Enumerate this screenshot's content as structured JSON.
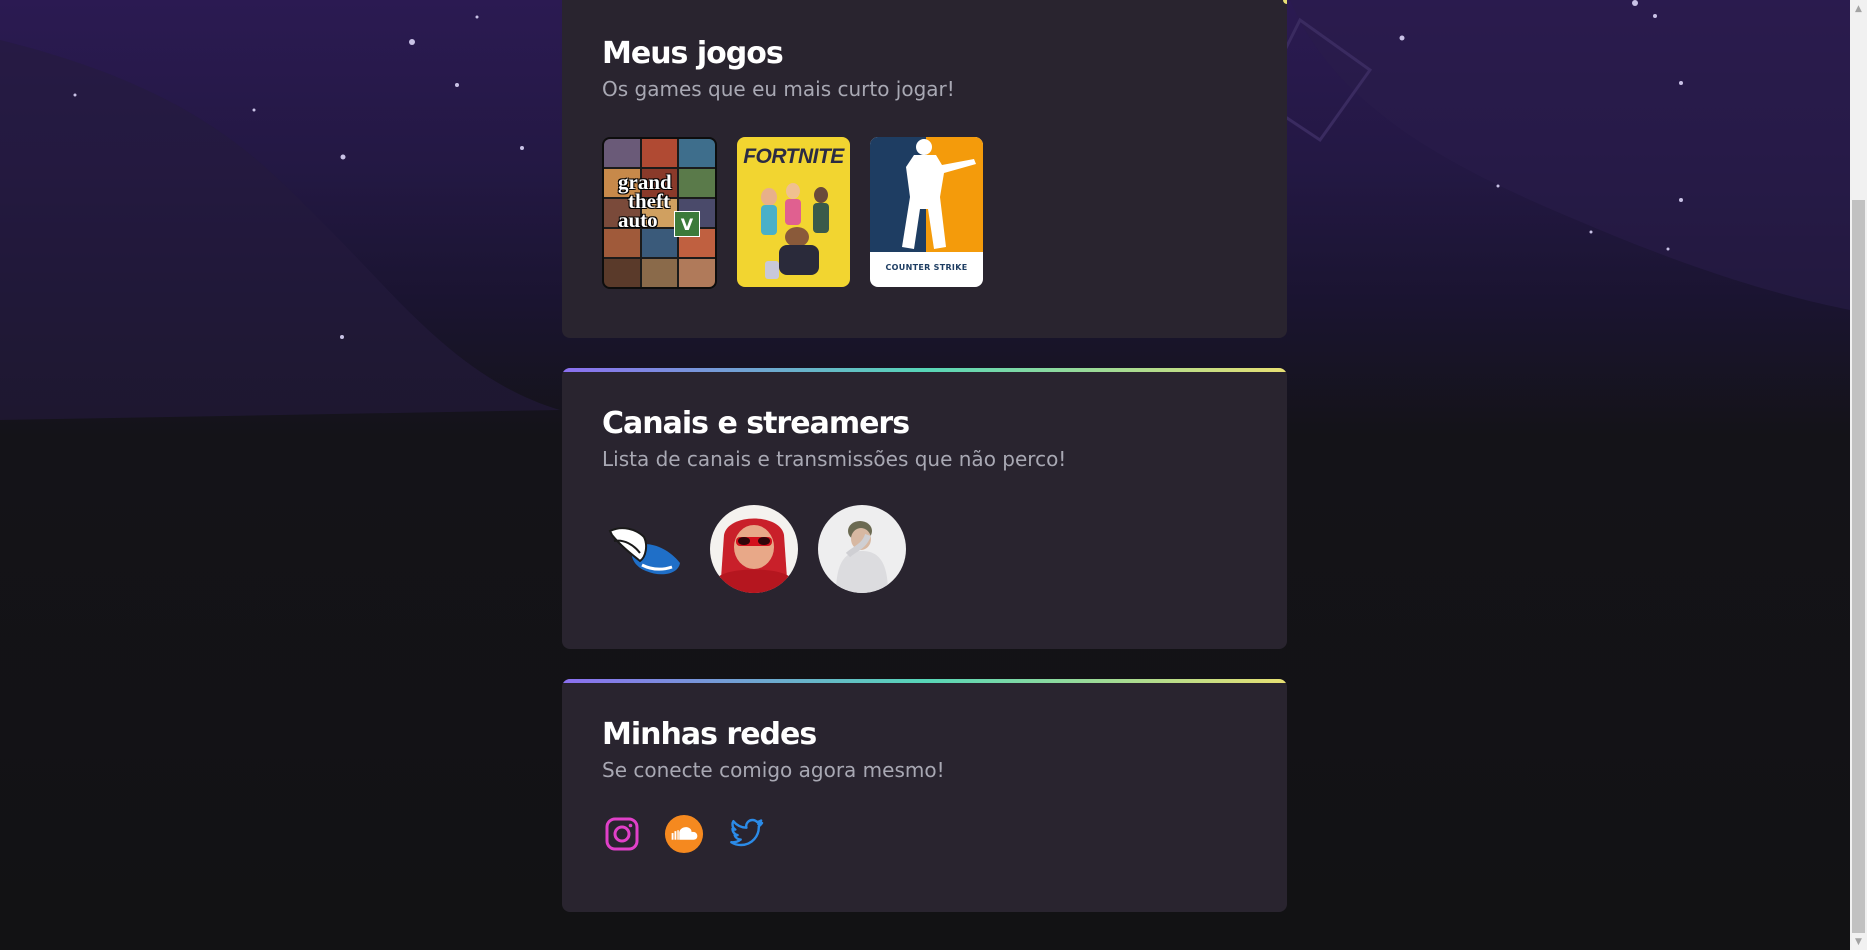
{
  "sections": {
    "games": {
      "title": "Meus jogos",
      "subtitle": "Os games que eu mais curto jogar!",
      "items": [
        {
          "name": "Grand Theft Auto V",
          "cover_text": [
            "grand",
            "theft",
            "auto"
          ],
          "badge": "V"
        },
        {
          "name": "Fortnite",
          "cover_text": "FORTNITE"
        },
        {
          "name": "Counter-Strike",
          "cover_text": "COUNTER STRIKE"
        }
      ]
    },
    "streamers": {
      "title": "Canais e streamers",
      "subtitle": "Lista de canais e transmissões que não perco!",
      "items": [
        {
          "icon": "winged-shoe-logo"
        },
        {
          "icon": "streamer-red-hoodie-avatar"
        },
        {
          "icon": "streamer-white-shirt-avatar"
        }
      ]
    },
    "socials": {
      "title": "Minhas redes",
      "subtitle": "Se conecte comigo agora mesmo!",
      "items": [
        {
          "icon": "instagram-icon",
          "color": "#e040c8"
        },
        {
          "icon": "soundcloud-icon",
          "color": "#f5891f"
        },
        {
          "icon": "twitter-icon",
          "color": "#2b8be8"
        }
      ]
    }
  },
  "scrollbar": {
    "up_arrow": "▲",
    "down_arrow": "▼"
  }
}
